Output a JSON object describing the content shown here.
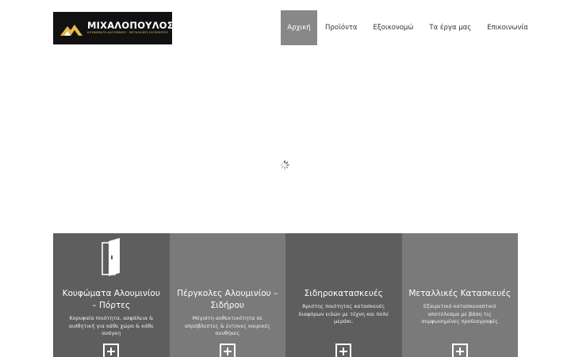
{
  "logo": {
    "name": "ΜΙΧΑΛΟΠΟΥΛΟΣ",
    "tagline": "ΚΟΥΦΩΜΑΤΑ ΑΛΟΥΜΙΝΙΟΥ · ΜΕΤΑΛΛΙΚΕΣ ΚΑΤΑΣΚΕΥΕΣ",
    "icon": "roof-house-logo-icon",
    "colors": {
      "background": "#111111",
      "accent": "#e8b84a",
      "text": "#ffffff"
    }
  },
  "nav": {
    "items": [
      {
        "label": "Αρχική",
        "active": true
      },
      {
        "label": "Προϊόντα",
        "active": false
      },
      {
        "label": "Εξοικονομώ",
        "active": false
      },
      {
        "label": "Τα έργα μας",
        "active": false
      },
      {
        "label": "Επικοινωνία",
        "active": false
      }
    ],
    "active_color": "#888888"
  },
  "slider": {
    "state": "loading",
    "icon": "loading-spinner-icon"
  },
  "features": [
    {
      "title": "Κουφώματα Αλουμινίου – Πόρτες",
      "description": "Κορυφαία ποιότητα, ασφάλεια & αισθητική για κάθε χώρο & κάθε ανάγκη",
      "icon": "door-icon",
      "more_icon": "plus-icon"
    },
    {
      "title": "Πέργκολες Αλουμινίου – Σιδήρου",
      "description": "Μέγιστη ανθεκτικότητα σε απρόβλεπτες & έντονες καιρικές συνθήκες",
      "more_icon": "plus-icon"
    },
    {
      "title": "Σιδηροκατασκευές",
      "description": "Άριστης ποιότητας κατασκευές διαφόρων ειδών με τέχνη και πολύ μεράκι.",
      "more_icon": "plus-icon"
    },
    {
      "title": "Μεταλλικές Κατασκευές",
      "description": "Εξαιρετικό κατασκευαστικό αποτέλεσμα με βάση τις συμφωνημένες προδιαγραφές",
      "more_icon": "plus-icon"
    }
  ],
  "colors": {
    "panel_dark": "#5e5e5e",
    "panel_light": "#7a7a7a"
  }
}
